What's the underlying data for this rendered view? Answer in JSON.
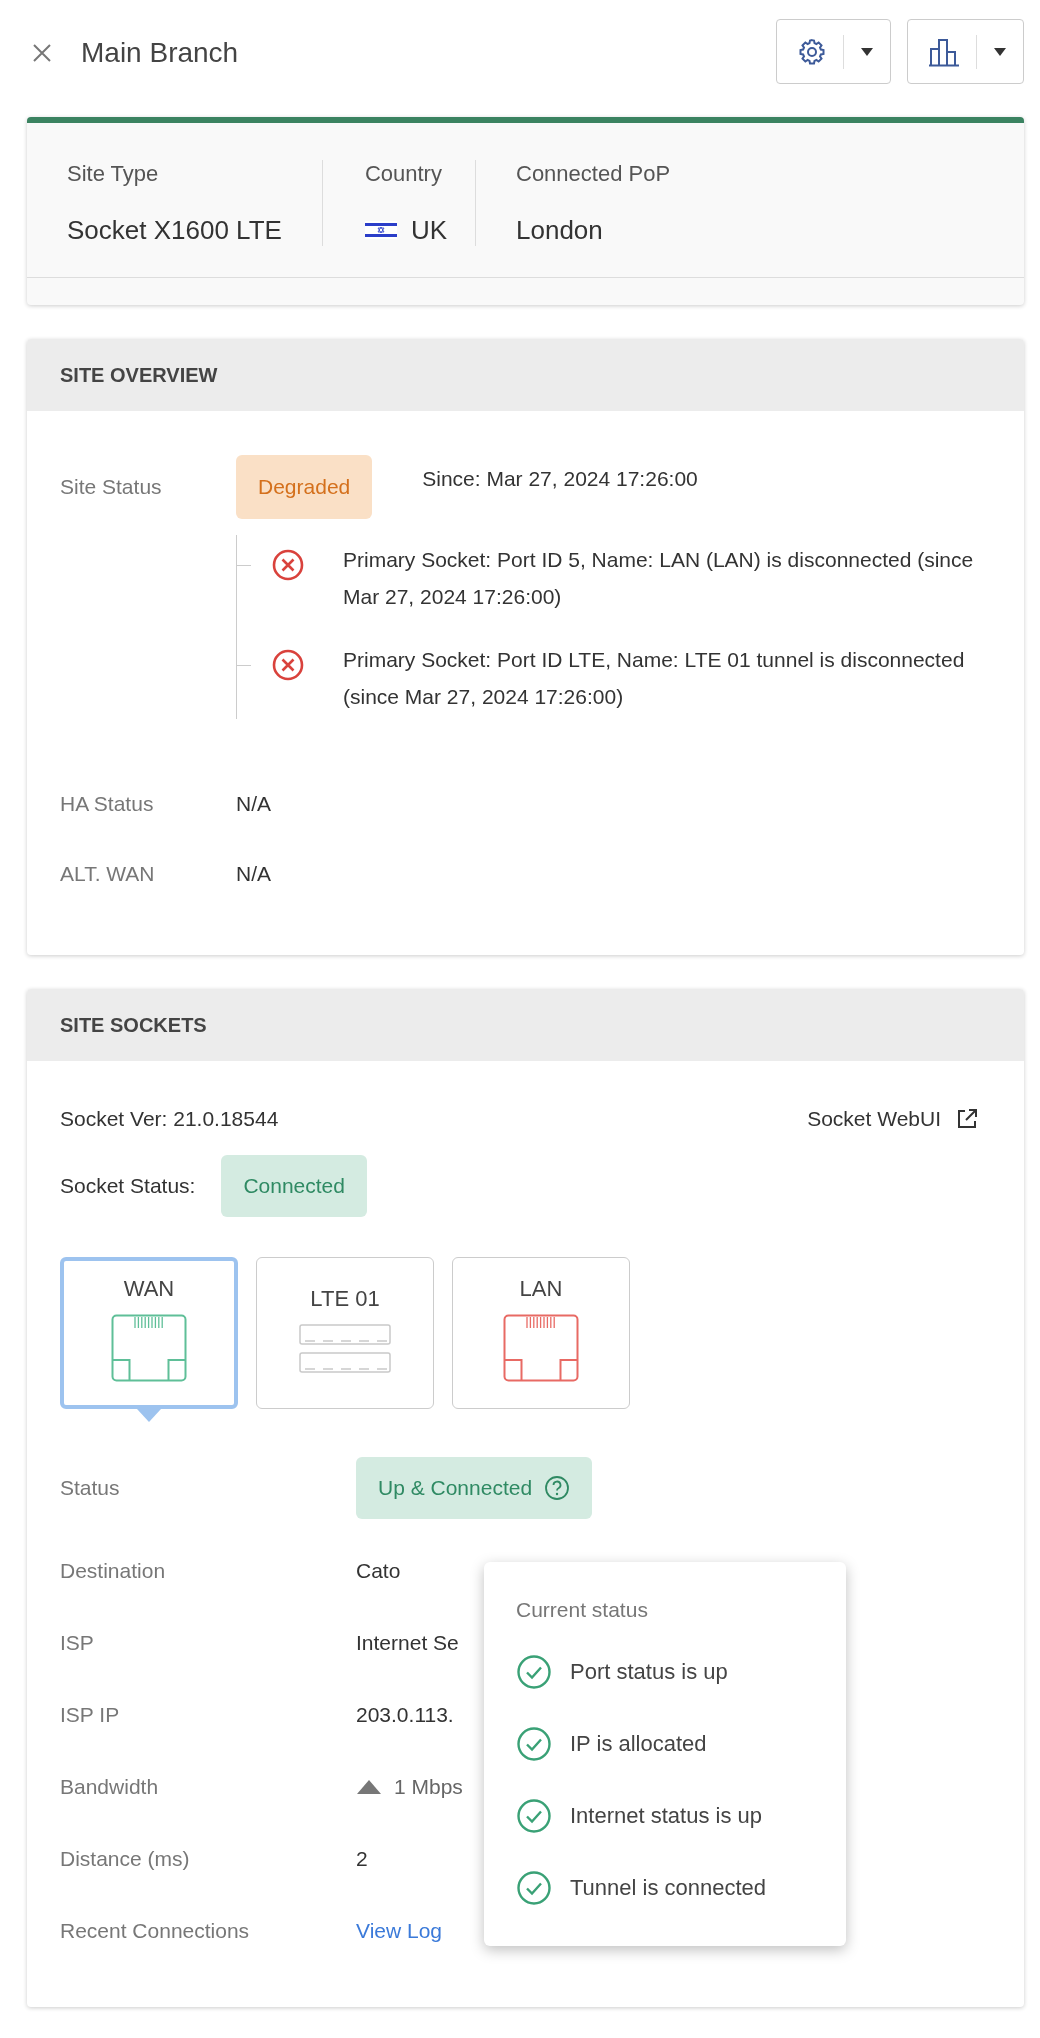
{
  "header": {
    "title": "Main Branch"
  },
  "summary": [
    {
      "label": "Site Type",
      "value": "Socket X1600 LTE",
      "flag": false
    },
    {
      "label": "Country",
      "value": "UK",
      "flag": true
    },
    {
      "label": "Connected PoP",
      "value": "London",
      "flag": false
    }
  ],
  "overview": {
    "heading": "SITE OVERVIEW",
    "site_status": {
      "label": "Site Status",
      "badge": "Degraded",
      "warning": true,
      "since": "Since: Mar 27, 2024 17:26:00",
      "issues": [
        {
          "kind": "error",
          "text": "Primary Socket: Port ID 5, Name: LAN (LAN) is disconnected (since Mar 27, 2024 17:26:00)"
        },
        {
          "kind": "error",
          "text": "Primary Socket: Port ID LTE, Name: LTE 01 tunnel is disconnected (since Mar 27, 2024 17:26:00)"
        }
      ]
    },
    "rows": [
      {
        "label": "HA Status",
        "value": "N/A"
      },
      {
        "label": "ALT. WAN",
        "value": "N/A"
      }
    ]
  },
  "sockets": {
    "heading": "SITE SOCKETS",
    "version": "Socket Ver: 21.0.18544",
    "webui": "Socket WebUI",
    "status_label": "Socket Status:",
    "status_badge": "Connected",
    "ports": [
      {
        "label": "WAN",
        "kind": "ethernet",
        "color": "#5fbf98",
        "selected": true
      },
      {
        "label": "LTE 01",
        "kind": "lte",
        "color": "#c9c9c9",
        "selected": false
      },
      {
        "label": "LAN",
        "kind": "ethernet",
        "color": "#e86a64",
        "selected": false
      }
    ],
    "details": [
      {
        "label": "Status",
        "kind": "badge",
        "value": "Up & Connected"
      },
      {
        "label": "Destination",
        "kind": "text",
        "value": "Cato"
      },
      {
        "label": "ISP",
        "kind": "text",
        "value": "Internet Se"
      },
      {
        "label": "ISP IP",
        "kind": "text",
        "value": "203.0.113."
      },
      {
        "label": "Bandwidth",
        "kind": "bandwidth",
        "value": "1 Mbps"
      },
      {
        "label": "Distance (ms)",
        "kind": "text",
        "value": "2"
      },
      {
        "label": "Recent Connections",
        "kind": "link",
        "value": "View Log"
      }
    ],
    "tooltip": {
      "title": "Current status",
      "items": [
        {
          "text": "Port status is up",
          "ok": true
        },
        {
          "text": "IP is allocated",
          "ok": true
        },
        {
          "text": "Internet status is up",
          "ok": true
        },
        {
          "text": "Tunnel is connected",
          "ok": true
        }
      ]
    }
  }
}
